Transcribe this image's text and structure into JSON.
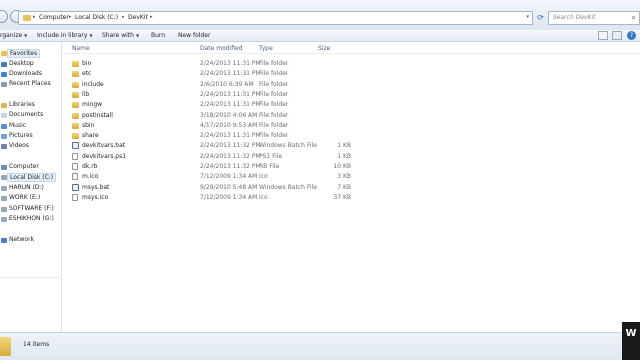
{
  "address": {
    "crumbs": [
      "Computer",
      "Local Disk (C:)",
      "DevKit"
    ],
    "search_placeholder": "Search DevKit"
  },
  "toolbar": {
    "organize": "rganize",
    "include_in_library": "Include in library",
    "share_with": "Share with",
    "burn": "Burn",
    "new_folder": "New folder",
    "help": "?"
  },
  "nav": {
    "favorites": "Favorites",
    "desktop": "Desktop",
    "downloads": "Downloads",
    "recent_places": "Recent Places",
    "libraries": "Libraries",
    "documents": "Documents",
    "music": "Music",
    "pictures": "Pictures",
    "videos": "Videos",
    "computer": "Computer",
    "local_disk": "Local Disk (C:)",
    "harun": "HARUN (D:)",
    "work": "WORK (E:)",
    "software": "SOFTWARE (F:)",
    "eshikhon": "ESHIKHON (G:)",
    "network": "Network"
  },
  "columns": {
    "name": "Name",
    "date_modified": "Date modified",
    "type": "Type",
    "size": "Size"
  },
  "files": [
    {
      "name": "bin",
      "date": "2/24/2013 11:31 PM",
      "type": "File folder",
      "size": "",
      "icon": "folder"
    },
    {
      "name": "etc",
      "date": "2/24/2013 11:31 PM",
      "type": "File folder",
      "size": "",
      "icon": "folder"
    },
    {
      "name": "include",
      "date": "2/6/2010 6:39 AM",
      "type": "File folder",
      "size": "",
      "icon": "folder"
    },
    {
      "name": "lib",
      "date": "2/24/2013 11:31 PM",
      "type": "File folder",
      "size": "",
      "icon": "folder"
    },
    {
      "name": "mingw",
      "date": "2/24/2013 11:31 PM",
      "type": "File folder",
      "size": "",
      "icon": "folder"
    },
    {
      "name": "postinstall",
      "date": "3/18/2010 4:06 AM",
      "type": "File folder",
      "size": "",
      "icon": "folder"
    },
    {
      "name": "sbin",
      "date": "4/17/2010 9:53 AM",
      "type": "File folder",
      "size": "",
      "icon": "folder"
    },
    {
      "name": "share",
      "date": "2/24/2013 11:31 PM",
      "type": "File folder",
      "size": "",
      "icon": "folder"
    },
    {
      "name": "devkitvars.bat",
      "date": "2/24/2013 11:32 PM",
      "type": "Windows Batch File",
      "size": "1 KB",
      "icon": "bat"
    },
    {
      "name": "devkitvars.ps1",
      "date": "2/24/2013 11:32 PM",
      "type": "PS1 File",
      "size": "1 KB",
      "icon": "file"
    },
    {
      "name": "dk.rb",
      "date": "2/24/2013 11:32 PM",
      "type": "RB File",
      "size": "10 KB",
      "icon": "file"
    },
    {
      "name": "m.ico",
      "date": "7/12/2009 1:34 AM",
      "type": "ico",
      "size": "3 KB",
      "icon": "file"
    },
    {
      "name": "msys.bat",
      "date": "9/29/2010 5:48 AM",
      "type": "Windows Batch File",
      "size": "7 KB",
      "icon": "bat"
    },
    {
      "name": "msys.ico",
      "date": "7/12/2009 1:34 AM",
      "type": "ico",
      "size": "37 KB",
      "icon": "file"
    }
  ],
  "status": {
    "item_count": "14 items"
  },
  "watermark": "W",
  "colors": {
    "folder": "#e8c25a",
    "selection": "#e5eef9",
    "header_text": "#4d6185"
  }
}
